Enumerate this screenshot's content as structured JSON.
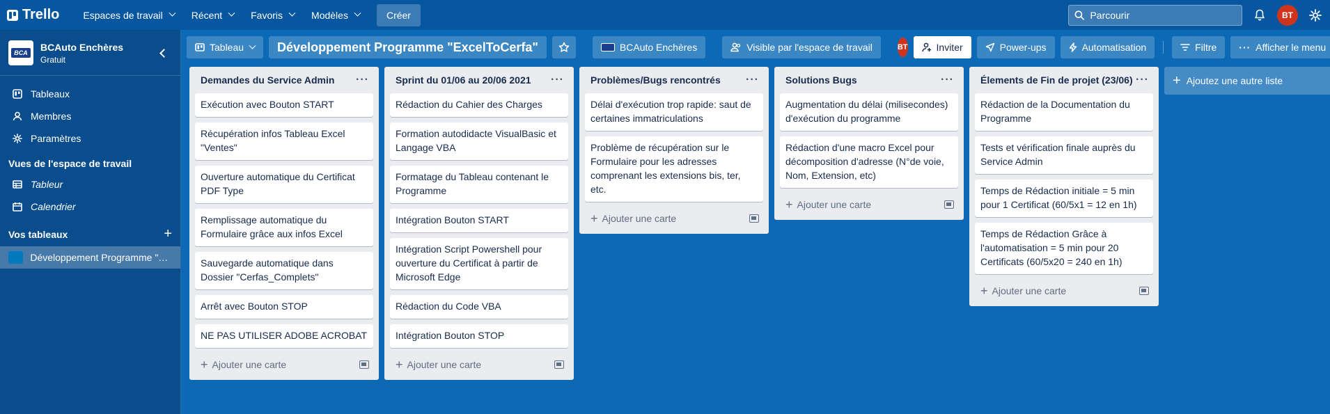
{
  "topbar": {
    "brand": "Trello",
    "nav": [
      {
        "label": "Espaces de travail"
      },
      {
        "label": "Récent"
      },
      {
        "label": "Favoris"
      },
      {
        "label": "Modèles"
      }
    ],
    "create_label": "Créer",
    "search_placeholder": "Parcourir",
    "user_initials": "BT"
  },
  "sidebar": {
    "workspace_name": "BCAuto Enchères",
    "workspace_plan": "Gratuit",
    "workspace_logo_text": "BCA",
    "items": [
      {
        "label": "Tableaux",
        "icon": "board-icon"
      },
      {
        "label": "Membres",
        "icon": "member-icon"
      },
      {
        "label": "Paramètres",
        "icon": "gear-icon"
      }
    ],
    "views_heading": "Vues de l'espace de travail",
    "views": [
      {
        "label": "Tableur",
        "icon": "table-icon"
      },
      {
        "label": "Calendrier",
        "icon": "calendar-icon"
      }
    ],
    "boards_heading": "Vos tableaux",
    "boards": [
      {
        "label": "Développement Programme \"E..."
      }
    ]
  },
  "board_header": {
    "view_label": "Tableau",
    "title": "Développement Programme \"ExcelToCerfa\"",
    "workspace_label": "BCAuto Enchères",
    "visibility_label": "Visible par l'espace de travail",
    "member_initials": "BT",
    "invite_label": "Inviter",
    "powerups_label": "Power-ups",
    "automation_label": "Automatisation",
    "filter_label": "Filtre",
    "menu_label": "Afficher le menu"
  },
  "lists": [
    {
      "title": "Demandes du Service Admin",
      "cards": [
        "Exécution avec Bouton START",
        "Récupération infos Tableau Excel \"Ventes\"",
        "Ouverture automatique du Certificat PDF Type",
        "Remplissage automatique du Formulaire grâce aux infos Excel",
        "Sauvegarde automatique dans Dossier \"Cerfas_Complets\"",
        "Arrêt avec Bouton STOP",
        "NE PAS UTILISER ADOBE ACROBAT"
      ]
    },
    {
      "title": "Sprint du 01/06 au 20/06 2021",
      "cards": [
        "Rédaction du Cahier des Charges",
        "Formation autodidacte VisualBasic et Langage VBA",
        "Formatage du Tableau contenant le Programme",
        "Intégration Bouton START",
        "Intégration Script Powershell pour ouverture du Certificat à partir de Microsoft Edge",
        "Rédaction du Code VBA",
        "Intégration Bouton STOP"
      ]
    },
    {
      "title": "Problèmes/Bugs rencontrés",
      "cards": [
        "Délai d'exécution trop rapide: saut de certaines immatriculations",
        "Problème de récupération sur le Formulaire pour les adresses comprenant les extensions bis, ter, etc."
      ]
    },
    {
      "title": "Solutions Bugs",
      "cards": [
        "Augmentation du délai (milisecondes) d'exécution du programme",
        "Rédaction d'une macro Excel pour décomposition d'adresse (N°de voie, Nom, Extension, etc)"
      ]
    },
    {
      "title": "Élements de Fin de projet (23/06)",
      "cards": [
        "Rédaction de la Documentation du Programme",
        "Tests et vérification finale auprès du Service Admin",
        "Temps de Rédaction initiale = 5 min pour 1 Certificat (60/5x1 = 12 en 1h)",
        "Temps de Rédaction Grâce à l'automatisation = 5 min pour 20 Certificats (60/5x20 = 240 en 1h)"
      ]
    }
  ],
  "add_card_label": "Ajouter une carte",
  "add_list_label": "Ajoutez une autre liste"
}
